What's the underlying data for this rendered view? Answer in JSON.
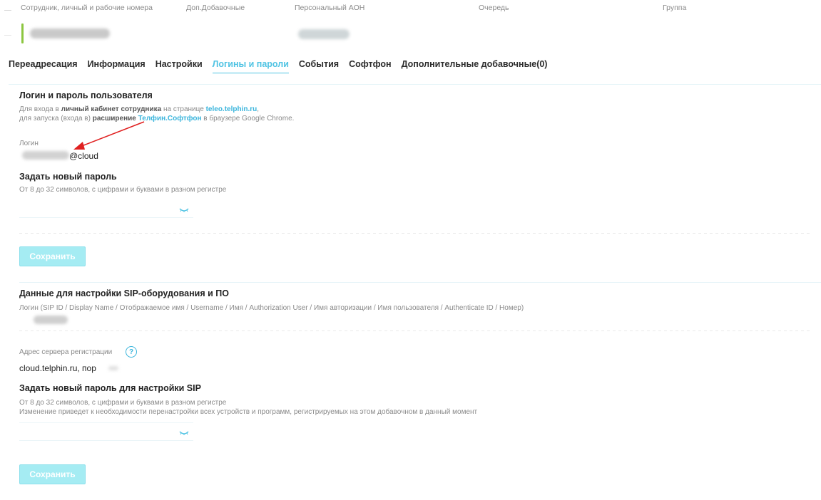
{
  "header": {
    "columns": [
      "Сотрудник, личный и рабочие номера",
      "Доп.Добавочные",
      "Персональный АОН",
      "Очередь",
      "Группа"
    ]
  },
  "tabs": [
    {
      "label": "Переадресация",
      "active": false
    },
    {
      "label": "Информация",
      "active": false
    },
    {
      "label": "Настройки",
      "active": false
    },
    {
      "label": "Логины и пароли",
      "active": true
    },
    {
      "label": "События",
      "active": false
    },
    {
      "label": "Софтфон",
      "active": false
    },
    {
      "label": "Дополнительные добавочные(0)",
      "active": false
    }
  ],
  "user_login": {
    "title": "Логин и пароль пользователя",
    "desc1_a": "Для входа в ",
    "desc1_b": "личный кабинет сотрудника",
    "desc1_c": " на странице ",
    "desc1_link": "teleo.telphin.ru",
    "desc1_d": ",",
    "desc2_a": "для запуска (входа в) ",
    "desc2_b": "расширение",
    "desc2_link": "Телфин.Софтфон",
    "desc2_c": " в браузере Google Chrome.",
    "login_label": "Логин",
    "login_suffix": "@cloud",
    "new_password_title": "Задать новый пароль",
    "password_hint": "От 8 до 32 символов, с цифрами и буквами в разном регистре",
    "save_label": "Сохранить"
  },
  "sip": {
    "title": "Данные для настройки SIP-оборудования и ПО",
    "login_hint": "Логин (SIP ID / Display Name / Отображаемое имя / Username / Имя / Authorization User / Имя авторизации / Имя пользователя / Authenticate ID / Номер)",
    "server_label": "Адрес сервера регистрации",
    "server_value": "cloud.telphin.ru, пор",
    "new_password_title": "Задать новый пароль для настройки SIP",
    "hint1": "От 8 до 32 символов, с цифрами и буквами в разном регистре",
    "hint2": "Изменение приведет к необходимости перенастройки всех устройств и программ, регистрируемых на этом добавочном в данный момент",
    "save_label": "Сохранить"
  },
  "colors": {
    "accent": "#4fc3e3",
    "link": "#3bb5dc",
    "status_green": "#8cc63f",
    "button_bg": "#a5ecf3",
    "arrow": "#e02020"
  },
  "icons": [
    "eye-icon",
    "help-icon",
    "arrow-annotation"
  ]
}
